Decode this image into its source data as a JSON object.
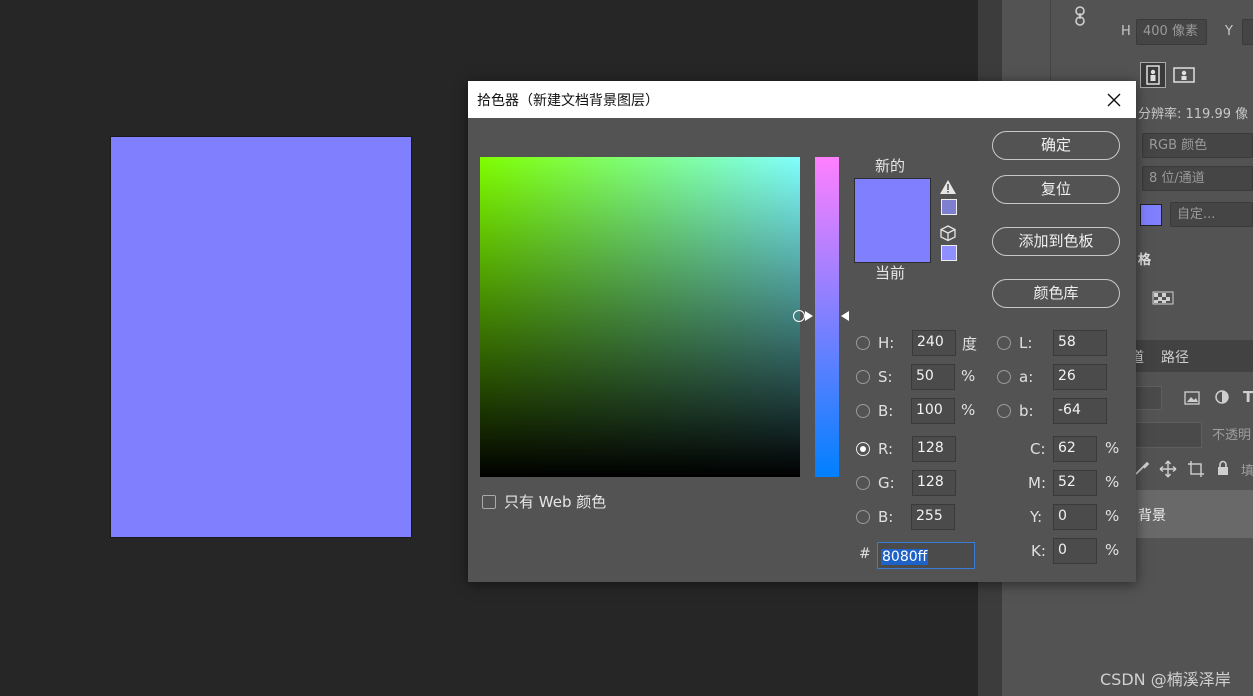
{
  "dialog": {
    "title": "拾色器（新建文档背景图层）",
    "new_label": "新的",
    "current_label": "当前",
    "buttons": {
      "ok": "确定",
      "reset": "复位",
      "add_to_swatches": "添加到色板",
      "color_libraries": "颜色库"
    },
    "only_web_colors": "只有 Web 颜色",
    "fields": {
      "H": {
        "label": "H:",
        "value": "240",
        "unit": "度"
      },
      "S": {
        "label": "S:",
        "value": "50",
        "unit": "%"
      },
      "Bri": {
        "label": "B:",
        "value": "100",
        "unit": "%"
      },
      "R": {
        "label": "R:",
        "value": "128"
      },
      "G": {
        "label": "G:",
        "value": "128"
      },
      "Blue": {
        "label": "B:",
        "value": "255"
      },
      "L": {
        "label": "L:",
        "value": "58"
      },
      "a": {
        "label": "a:",
        "value": "26"
      },
      "b": {
        "label": "b:",
        "value": "-64"
      },
      "C": {
        "label": "C:",
        "value": "62",
        "unit": "%"
      },
      "M": {
        "label": "M:",
        "value": "52",
        "unit": "%"
      },
      "Y": {
        "label": "Y:",
        "value": "0",
        "unit": "%"
      },
      "K": {
        "label": "K:",
        "value": "0",
        "unit": "%"
      }
    },
    "hex_label": "#",
    "hex_value": "8080ff",
    "selected_radio": "R",
    "colors": {
      "new": "#8080ff",
      "current": "#8080ff"
    }
  },
  "panels": {
    "height_label": "H",
    "height_value": "400 像素",
    "y_label": "Y",
    "resolution": "分辨率: 119.99 像",
    "color_mode": "RGB 颜色",
    "bit_depth": "8 位/通道",
    "background_option": "自定...",
    "grid_label": "格",
    "tabs": [
      "道",
      "路径"
    ],
    "opacity_label": "不透明",
    "fill_label": "填",
    "layer_name": "背景"
  },
  "canvas": {
    "fill_color": "#8080ff"
  },
  "watermark": "CSDN @楠溪泽岸"
}
